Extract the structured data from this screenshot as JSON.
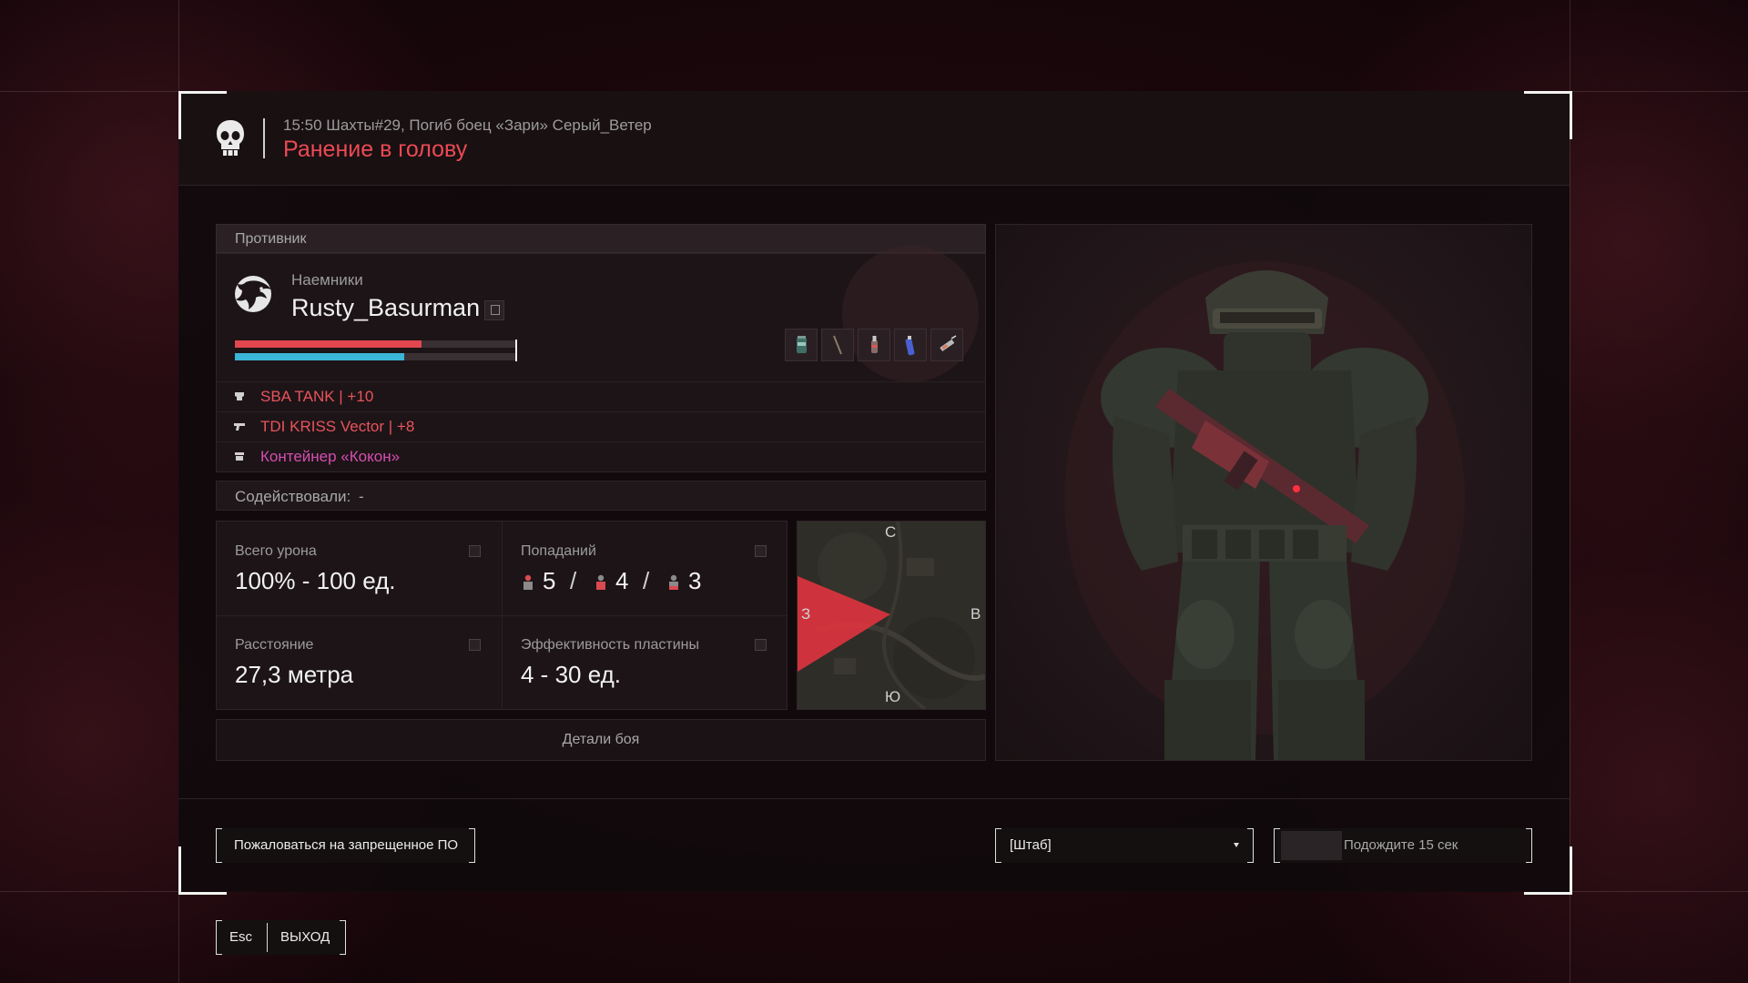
{
  "header": {
    "event_line": "15:50 Шахты#29, Погиб боец «Зари» Серый_Ветер",
    "death_cause": "Ранение в голову"
  },
  "enemy": {
    "section_title": "Противник",
    "faction": "Наемники",
    "player_name": "Rusty_Basurman",
    "health_fraction": 0.66,
    "armor_fraction": 0.6,
    "equipment": [
      {
        "icon": "armor-icon",
        "text": "SBA TANK | +10",
        "color": "#e8545c"
      },
      {
        "icon": "rifle-icon",
        "text": "TDI KRISS Vector | +8",
        "color": "#e8545c"
      },
      {
        "icon": "container-icon",
        "text": "Контейнер «Кокон»",
        "color": "#d44fb0"
      }
    ],
    "quick_slots": [
      "canister-icon",
      "stick-icon",
      "bottle-icon",
      "spray-icon",
      "syringe-icon"
    ]
  },
  "assist": {
    "label": "Содействовали:",
    "value": "-"
  },
  "stats": {
    "damage_label": "Всего урона",
    "damage_value": "100% - 100 ед.",
    "hits_label": "Попаданий",
    "hits": [
      "5",
      "4",
      "3"
    ],
    "distance_label": "Расстояние",
    "distance_value": "27,3 метра",
    "plate_label": "Эффективность пластины",
    "plate_value": "4 - 30 ед."
  },
  "minimap": {
    "north": "С",
    "south": "Ю",
    "west": "З",
    "east": "В"
  },
  "details_button": "Детали боя",
  "footer": {
    "report_button": "Пожаловаться на запрещенное ПО",
    "respawn_select": "[Штаб]",
    "wait_button": "Подождите 15 сек",
    "wait_progress_fraction": 0.25
  },
  "esc_key": "Esc",
  "exit_label": "ВЫХОД"
}
